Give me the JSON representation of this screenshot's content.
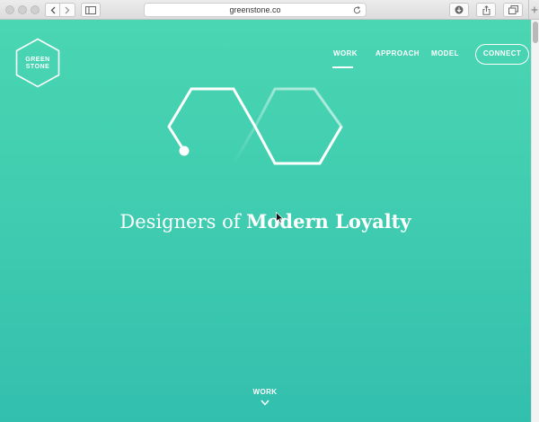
{
  "browser": {
    "url": "greenstone.co"
  },
  "logo": {
    "line1": "GREEN",
    "line2": "STONE"
  },
  "nav": {
    "items": [
      {
        "label": "WORK",
        "active": true
      },
      {
        "label": "APPROACH",
        "active": false
      },
      {
        "label": "MODEL",
        "active": false
      }
    ],
    "connect_label": "CONNECT"
  },
  "hero": {
    "headline_light": "Designers of",
    "headline_bold": "Modern Loyalty"
  },
  "scroll_hint": {
    "label": "WORK"
  },
  "colors": {
    "accent_top": "#4ad6b2",
    "accent_bottom": "#33bfae",
    "text": "#ffffff"
  },
  "icons": [
    "back-arrow-icon",
    "forward-arrow-icon",
    "sidebar-icon",
    "reload-icon",
    "download-icon",
    "share-icon",
    "tabs-icon",
    "hexagon-logo-icon",
    "chevron-down-icon",
    "cursor-icon"
  ]
}
